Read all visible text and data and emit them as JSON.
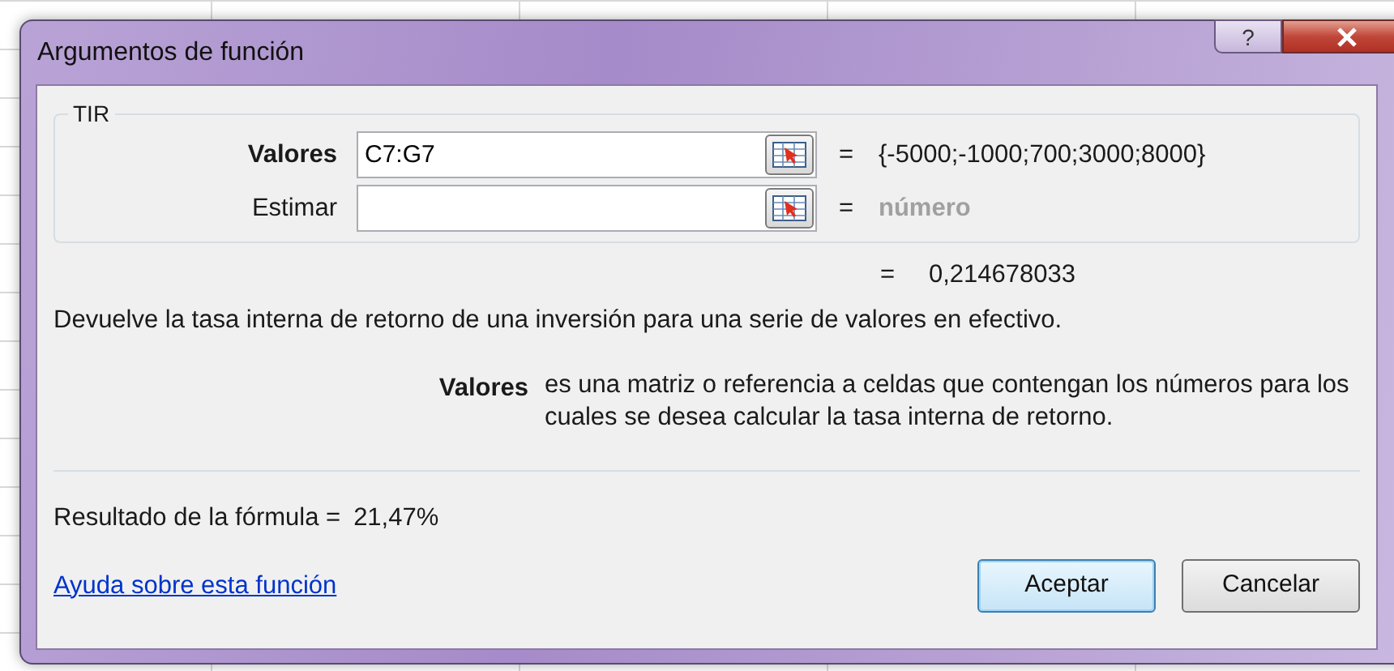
{
  "window": {
    "title": "Argumentos de función",
    "title_buttons": [
      {
        "kind": "help",
        "label": "?"
      },
      {
        "kind": "close"
      }
    ]
  },
  "function_name": "TIR",
  "arguments": [
    {
      "name": "Valores",
      "value": "C7:G7",
      "active": true,
      "equals": "=",
      "result": "{-5000;-1000;700;3000;8000}",
      "greyed": false
    },
    {
      "name": "Estimar",
      "active": false,
      "equals": "=",
      "result": "número",
      "greyed": true
    }
  ],
  "function_result": {
    "equals": "=",
    "value": "0,214678033"
  },
  "description": "Devuelve la tasa interna de retorno de una inversión para una serie de valores en efectivo.",
  "argument_help": {
    "name": "Valores",
    "text": "es una matriz o referencia a celdas que contengan los números para los cuales se desea calcular la tasa interna de retorno."
  },
  "formula_result": {
    "label": "Resultado de la fórmula =",
    "value": "21,47%"
  },
  "help_link": "Ayuda sobre esta función",
  "buttons": [
    {
      "label": "Aceptar",
      "default": true
    },
    {
      "label": "Cancelar",
      "default": false
    }
  ]
}
